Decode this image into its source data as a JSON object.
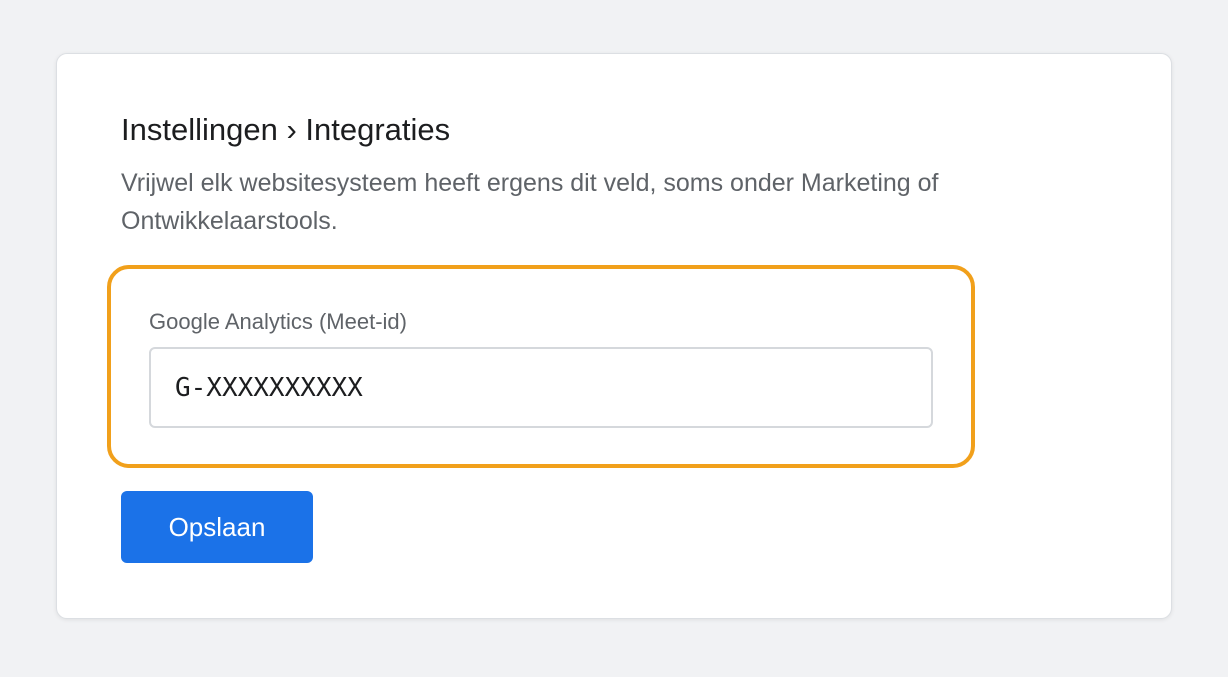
{
  "page": {
    "breadcrumb_title": "Instellingen › Integraties",
    "description": "Vrijwel elk websitesysteem heeft ergens dit veld, soms onder Marketing of Ontwikkelaarstools."
  },
  "field": {
    "label": "Google Analytics (Meet-id)",
    "value": "G-XXXXXXXXXX",
    "highlighted": true
  },
  "actions": {
    "save_label": "Opslaan"
  },
  "colors": {
    "background": "#f1f2f4",
    "card": "#ffffff",
    "highlight_border": "#f1a01b",
    "primary_button": "#1b72e8",
    "muted_text": "#5f6368"
  }
}
